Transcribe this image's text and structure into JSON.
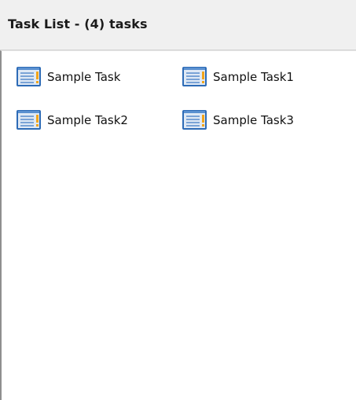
{
  "header": {
    "title": "Task List - (4) tasks"
  },
  "tasks": [
    {
      "label": "Sample Task",
      "icon": "task-icon"
    },
    {
      "label": "Sample Task1",
      "icon": "task-icon"
    },
    {
      "label": "Sample Task2",
      "icon": "task-icon"
    },
    {
      "label": "Sample Task3",
      "icon": "task-icon"
    }
  ],
  "colors": {
    "header_bg": "#f0f0f0",
    "icon_blue": "#2d6bb6",
    "icon_light": "#dfe9f5",
    "icon_accent": "#f2a51a",
    "text": "#111111"
  }
}
